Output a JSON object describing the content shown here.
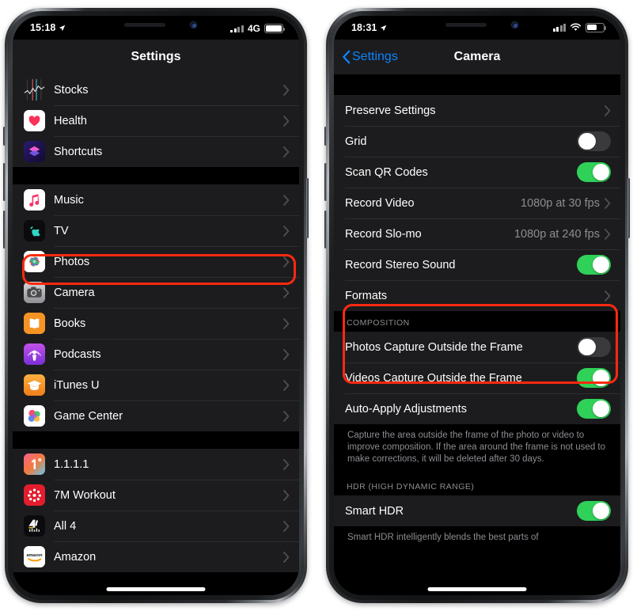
{
  "left_phone": {
    "status": {
      "time": "15:18",
      "location_icon": "location-arrow-icon",
      "signal_icon": "cellular-bars-icon",
      "carrier": "4G",
      "battery_icon": "battery-icon"
    },
    "nav": {
      "title": "Settings"
    },
    "groups": [
      {
        "rows": [
          {
            "label": "Stocks",
            "icon": "stocks-app-icon",
            "accessory": "chevron"
          },
          {
            "label": "Health",
            "icon": "health-app-icon",
            "accessory": "chevron"
          },
          {
            "label": "Shortcuts",
            "icon": "shortcuts-app-icon",
            "accessory": "chevron"
          }
        ]
      },
      {
        "rows": [
          {
            "label": "Music",
            "icon": "music-app-icon",
            "accessory": "chevron"
          },
          {
            "label": "TV",
            "icon": "tv-app-icon",
            "accessory": "chevron"
          },
          {
            "label": "Photos",
            "icon": "photos-app-icon",
            "accessory": "chevron"
          },
          {
            "label": "Camera",
            "icon": "camera-app-icon",
            "accessory": "chevron",
            "highlighted": true
          },
          {
            "label": "Books",
            "icon": "books-app-icon",
            "accessory": "chevron"
          },
          {
            "label": "Podcasts",
            "icon": "podcasts-app-icon",
            "accessory": "chevron"
          },
          {
            "label": "iTunes U",
            "icon": "itunesu-app-icon",
            "accessory": "chevron"
          },
          {
            "label": "Game Center",
            "icon": "gamecenter-app-icon",
            "accessory": "chevron"
          }
        ]
      },
      {
        "rows": [
          {
            "label": "1.1.1.1",
            "icon": "cloudflare-app-icon",
            "accessory": "chevron"
          },
          {
            "label": "7M Workout",
            "icon": "7mworkout-app-icon",
            "accessory": "chevron"
          },
          {
            "label": "All 4",
            "icon": "all4-app-icon",
            "accessory": "chevron"
          },
          {
            "label": "Amazon",
            "icon": "amazon-app-icon",
            "accessory": "chevron"
          }
        ]
      }
    ]
  },
  "right_phone": {
    "status": {
      "time": "18:31",
      "location_icon": "location-arrow-icon",
      "signal_icon": "cellular-bars-icon",
      "wifi_icon": "wifi-icon",
      "battery_icon": "battery-icon"
    },
    "nav": {
      "back_label": "Settings",
      "title": "Camera"
    },
    "group_main": {
      "rows": [
        {
          "label": "Preserve Settings",
          "accessory": "chevron"
        },
        {
          "label": "Grid",
          "accessory": "toggle",
          "value": "off"
        },
        {
          "label": "Scan QR Codes",
          "accessory": "toggle",
          "value": "on"
        },
        {
          "label": "Record Video",
          "accessory": "chevron",
          "value": "1080p at 30 fps"
        },
        {
          "label": "Record Slo-mo",
          "accessory": "chevron",
          "value": "1080p at 240 fps"
        },
        {
          "label": "Record Stereo Sound",
          "accessory": "toggle",
          "value": "on"
        },
        {
          "label": "Formats",
          "accessory": "chevron"
        }
      ]
    },
    "composition": {
      "header": "COMPOSITION",
      "rows": [
        {
          "label": "Photos Capture Outside the Frame",
          "accessory": "toggle",
          "value": "off",
          "highlighted": true
        },
        {
          "label": "Videos Capture Outside the Frame",
          "accessory": "toggle",
          "value": "on",
          "highlighted": true
        },
        {
          "label": "Auto-Apply Adjustments",
          "accessory": "toggle",
          "value": "on"
        }
      ],
      "footnote": "Capture the area outside the frame of the photo or video to improve composition. If the area around the frame is not used to make corrections, it will be deleted after 30 days."
    },
    "hdr": {
      "header": "HDR (HIGH DYNAMIC RANGE)",
      "rows": [
        {
          "label": "Smart HDR",
          "accessory": "toggle",
          "value": "on"
        }
      ],
      "footnote": "Smart HDR intelligently blends the best parts of"
    }
  },
  "colors": {
    "accent_blue": "#0a84ff",
    "toggle_on": "#30d158",
    "toggle_off": "#3a3a3c",
    "row_bg": "#1c1c1e",
    "page_bg": "#000000",
    "annotation_red": "#fa2a10",
    "secondary_text": "#8d8d93"
  }
}
